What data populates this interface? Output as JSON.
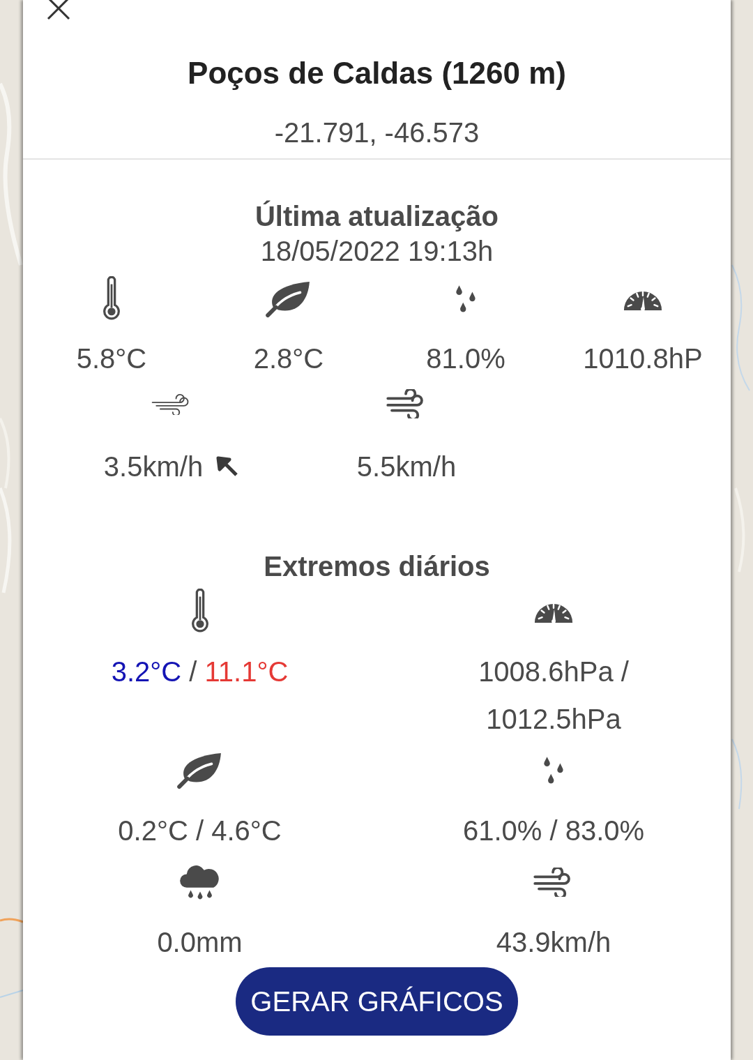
{
  "header": {
    "title": "Poços de Caldas (1260 m)",
    "coordinates": "-21.791, -46.573"
  },
  "current": {
    "title": "Última atualização",
    "timestamp": "18/05/2022 19:13h",
    "readings": [
      {
        "kind": "temperature",
        "value": "5.8°C"
      },
      {
        "kind": "dew_point",
        "value": "2.8°C"
      },
      {
        "kind": "humidity",
        "value": "81.0%"
      },
      {
        "kind": "pressure",
        "value": "1010.8hP"
      }
    ],
    "wind": [
      {
        "kind": "wind_mean",
        "value": "3.5km/h"
      },
      {
        "kind": "wind_gust",
        "value": "5.5km/h"
      }
    ]
  },
  "extremes": {
    "title": "Extremos diários",
    "items": [
      {
        "kind": "temperature",
        "parts": [
          {
            "text": "3.2°C",
            "color": "#1414b4"
          },
          {
            "text": "/"
          },
          {
            "text": "11.1°C",
            "color": "#e53935"
          }
        ]
      },
      {
        "kind": "pressure",
        "parts": [
          {
            "text": "1008.6hPa / 1012.5hPa"
          }
        ]
      },
      {
        "kind": "dew_point",
        "parts": [
          {
            "text": "0.2°C / 4.6°C"
          }
        ]
      },
      {
        "kind": "humidity",
        "parts": [
          {
            "text": "61.0% / 83.0%"
          }
        ]
      },
      {
        "kind": "rain",
        "parts": [
          {
            "text": "0.0mm"
          }
        ]
      },
      {
        "kind": "wind_gust",
        "parts": [
          {
            "text": "43.9km/h"
          }
        ]
      }
    ]
  },
  "button": {
    "label": "GERAR GRÁFICOS"
  }
}
